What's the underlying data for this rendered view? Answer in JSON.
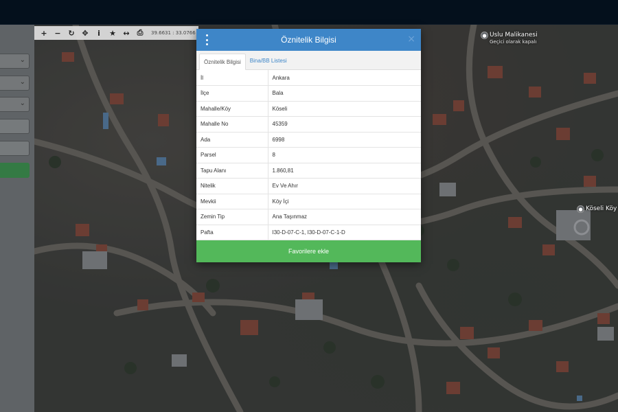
{
  "sidebar": {
    "select_chevron": "⌄"
  },
  "map_toolbar": {
    "coordinates": "39.6631 : 33.0766"
  },
  "map_labels": {
    "place1_name": "Uslu Malikanesi",
    "place1_sub": "Geçici olarak kapalı",
    "place2_name": "Köseli Köy"
  },
  "modal": {
    "title": "Öznitelik Bilgisi",
    "close_glyph": "×",
    "tabs": [
      "Öznitelik Bilgisi",
      "Bina/BB Listesi"
    ],
    "rows": [
      {
        "key": "İl",
        "value": "Ankara"
      },
      {
        "key": "İlçe",
        "value": "Bala"
      },
      {
        "key": "Mahalle/Köy",
        "value": "Köseli"
      },
      {
        "key": "Mahalle No",
        "value": "45359"
      },
      {
        "key": "Ada",
        "value": "6998"
      },
      {
        "key": "Parsel",
        "value": "8"
      },
      {
        "key": "Tapu Alanı",
        "value": "1.860,81"
      },
      {
        "key": "Nitelik",
        "value": "Ev Ve Ahır"
      },
      {
        "key": "Mevkii",
        "value": "Köy İçi"
      },
      {
        "key": "Zemin Tip",
        "value": "Ana Taşınmaz"
      },
      {
        "key": "Pafta",
        "value": "I30-D-07-C-1, I30-D-07-C-1-D"
      }
    ],
    "favorite_button": "Favorilere ekle"
  }
}
